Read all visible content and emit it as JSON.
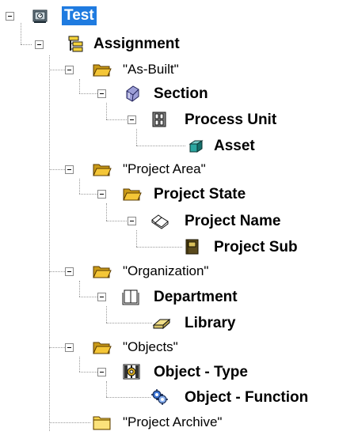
{
  "tree": {
    "root": {
      "label": "Test",
      "icon": "database-server-icon"
    },
    "assignment": {
      "label": "Assignment",
      "icon": "hierarchy-icon"
    },
    "as_built": {
      "label": "\"As-Built\"",
      "icon": "folder-open-icon"
    },
    "section": {
      "label": "Section",
      "icon": "cube-section-icon"
    },
    "process_unit": {
      "label": "Process Unit",
      "icon": "building-icon"
    },
    "asset": {
      "label": "Asset",
      "icon": "teal-cube-icon"
    },
    "project_area": {
      "label": "\"Project Area\"",
      "icon": "folder-open-icon"
    },
    "project_state": {
      "label": "Project State",
      "icon": "folder-open-icon"
    },
    "project_name": {
      "label": "Project Name",
      "icon": "open-book-icon"
    },
    "project_sub": {
      "label": "Project Sub",
      "icon": "closed-book-icon"
    },
    "organization": {
      "label": "\"Organization\"",
      "icon": "folder-open-icon"
    },
    "department": {
      "label": "Department",
      "icon": "book-outline-icon"
    },
    "library": {
      "label": "Library",
      "icon": "eraser-book-icon"
    },
    "objects": {
      "label": "\"Objects\"",
      "icon": "folder-open-icon"
    },
    "object_type": {
      "label": "Object - Type",
      "icon": "gear-frame-icon"
    },
    "object_function": {
      "label": "Object - Function",
      "icon": "gears-icon"
    },
    "project_archive": {
      "label": "\"Project Archive\"",
      "icon": "folder-closed-icon"
    }
  },
  "colors": {
    "selection": "#1f7be0",
    "folder": "#f2c12e",
    "connector": "#9a9a9a"
  }
}
